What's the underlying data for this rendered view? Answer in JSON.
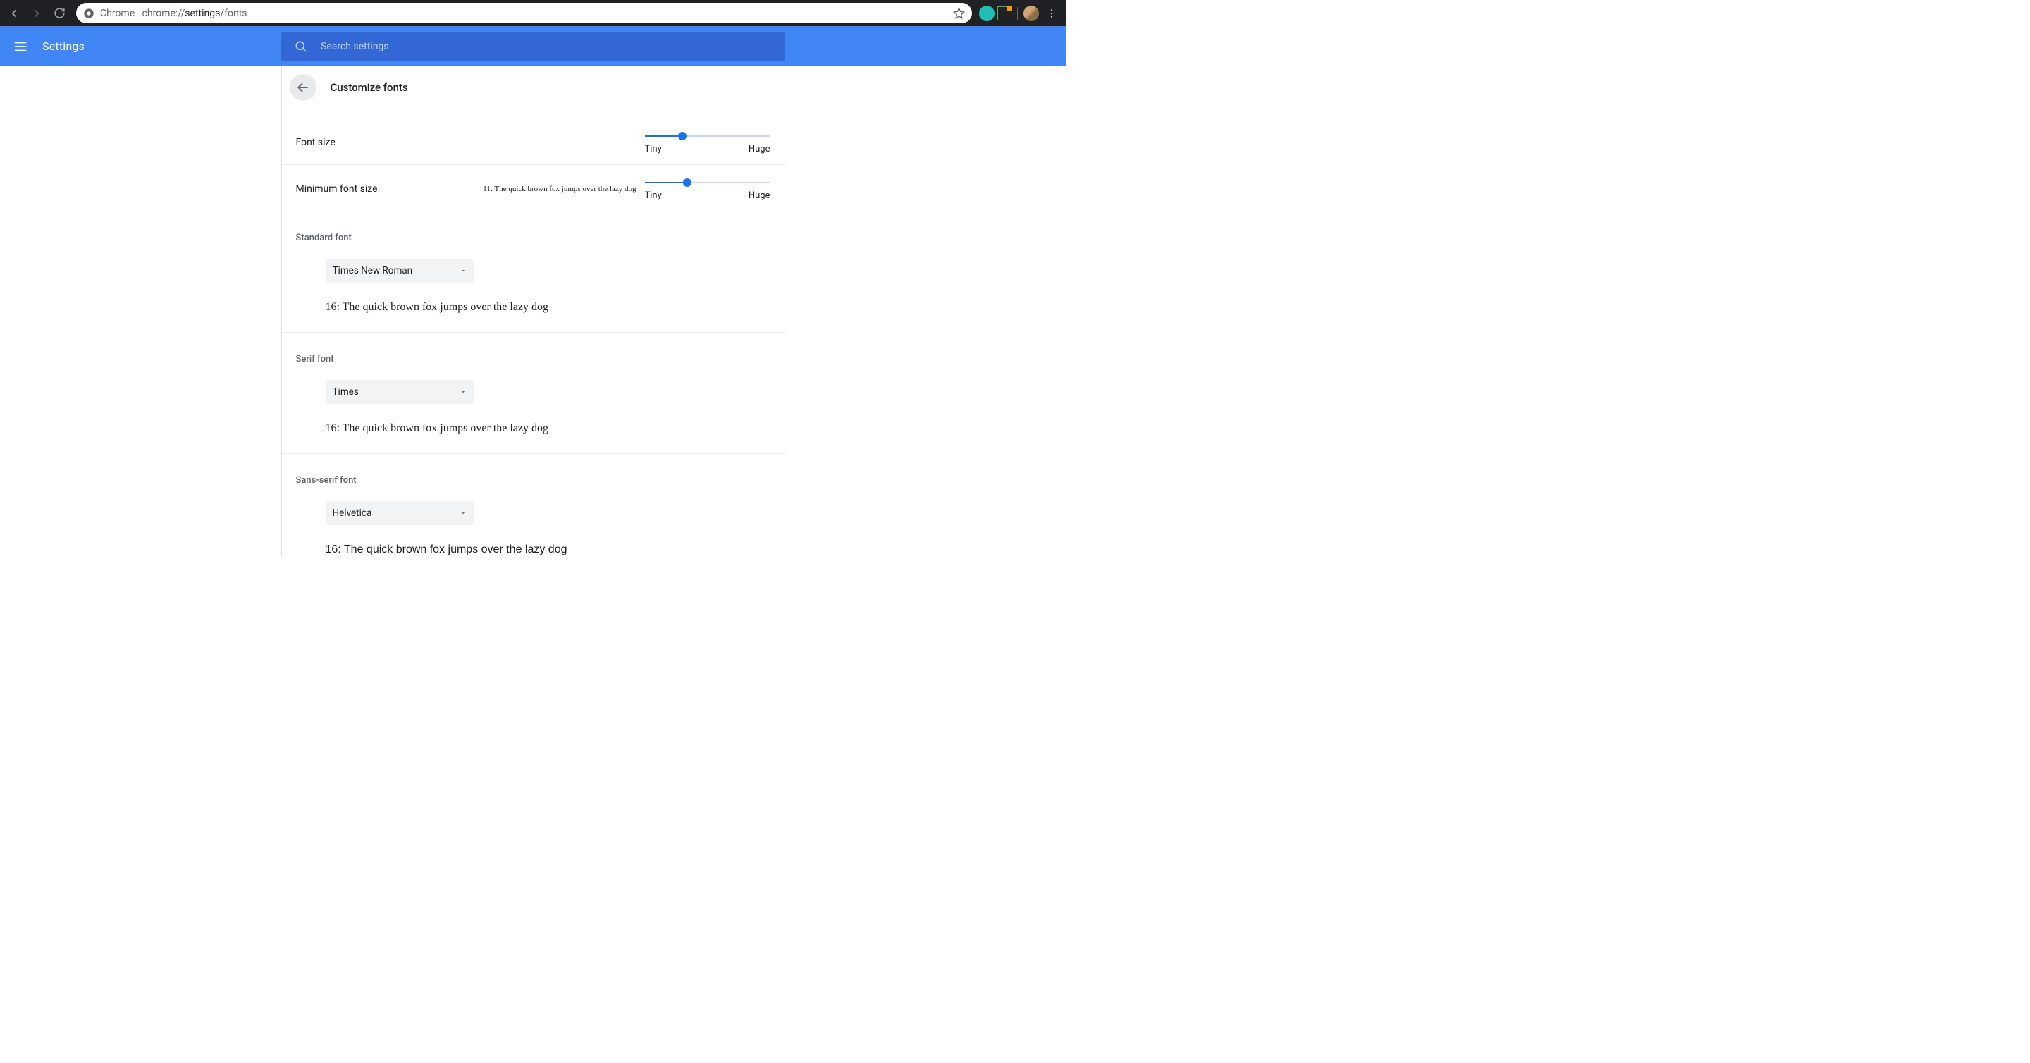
{
  "browser": {
    "app_label": "Chrome",
    "url_prefix": "chrome://",
    "url_bold": "settings",
    "url_suffix": "/fonts"
  },
  "header": {
    "title": "Settings",
    "search_placeholder": "Search settings"
  },
  "page": {
    "title": "Customize fonts"
  },
  "font_size": {
    "label": "Font size",
    "tiny": "Tiny",
    "huge": "Huge",
    "percent": 30
  },
  "min_font_size": {
    "label": "Minimum font size",
    "tiny": "Tiny",
    "huge": "Huge",
    "percent": 34,
    "preview": "11: The quick brown fox jumps over the lazy dog"
  },
  "standard_font": {
    "label": "Standard font",
    "value": "Times New Roman",
    "preview": "16: The quick brown fox jumps over the lazy dog"
  },
  "serif_font": {
    "label": "Serif font",
    "value": "Times",
    "preview": "16: The quick brown fox jumps over the lazy dog"
  },
  "sans_font": {
    "label": "Sans-serif font",
    "value": "Helvetica",
    "preview": "16: The quick brown fox jumps over the lazy dog"
  }
}
